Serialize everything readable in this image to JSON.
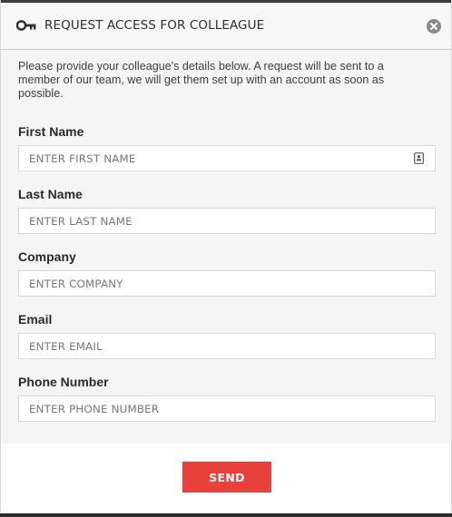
{
  "dialog": {
    "title": "REQUEST ACCESS FOR COLLEAGUE",
    "icon": "key-icon",
    "close_icon": "close-icon",
    "intro": "Please provide your colleague's details below. A request will be sent to a member of our team, we will get them set up with an account as soon as possible."
  },
  "form": {
    "first_name": {
      "label": "First Name",
      "placeholder": "ENTER FIRST NAME",
      "value": ""
    },
    "last_name": {
      "label": "Last Name",
      "placeholder": "ENTER LAST NAME",
      "value": ""
    },
    "company": {
      "label": "Company",
      "placeholder": "ENTER COMPANY",
      "value": ""
    },
    "email": {
      "label": "Email",
      "placeholder": "ENTER EMAIL",
      "value": ""
    },
    "phone": {
      "label": "Phone Number",
      "placeholder": "ENTER PHONE NUMBER",
      "value": ""
    }
  },
  "footer": {
    "send_label": "SEND"
  },
  "colors": {
    "accent": "#e8403a",
    "background": "#f5f5f5",
    "footer_background": "#ffffff"
  }
}
